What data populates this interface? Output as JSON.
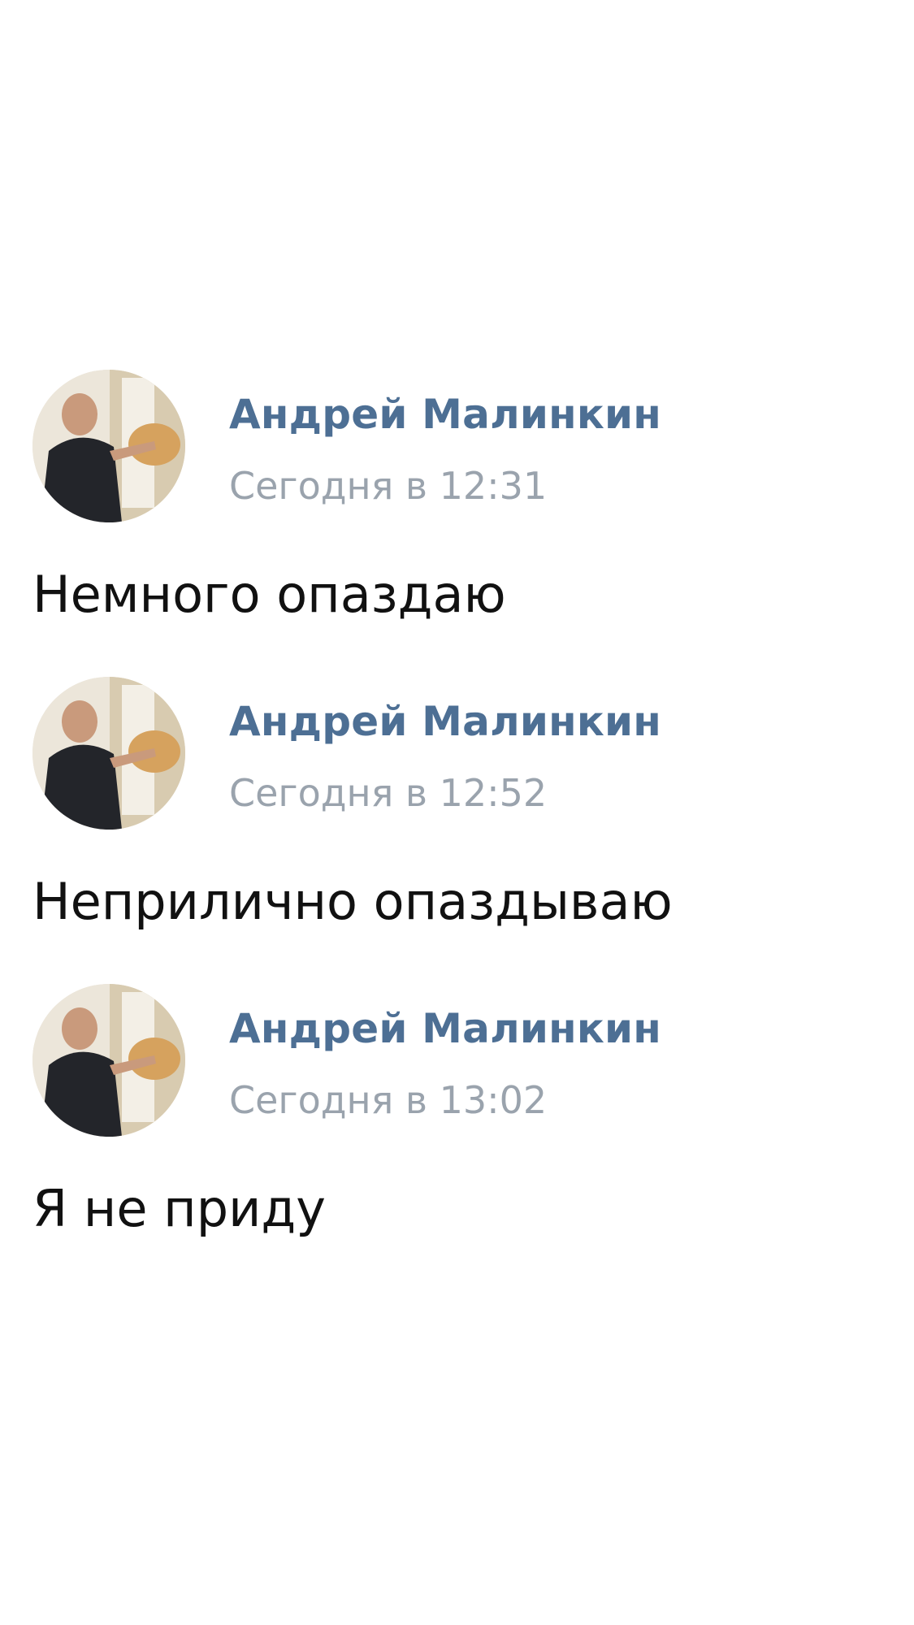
{
  "posts": [
    {
      "author": "Андрей Малинкин",
      "time": "Сегодня в 12:31",
      "text": "Немного опаздаю",
      "avatar_icon": "user-photo-avatar"
    },
    {
      "author": "Андрей Малинкин",
      "time": "Сегодня в 12:52",
      "text": "Неприлично опаздываю",
      "avatar_icon": "user-photo-avatar"
    },
    {
      "author": "Андрей Малинкин",
      "time": "Сегодня в 13:02",
      "text": "Я не приду",
      "avatar_icon": "user-photo-avatar"
    }
  ],
  "colors": {
    "author_name": "#4d6f94",
    "timestamp": "#9aa3ad",
    "message_text": "#111111",
    "background": "#ffffff"
  }
}
